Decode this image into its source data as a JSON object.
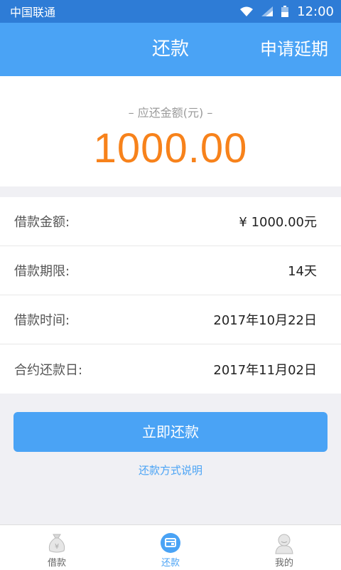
{
  "status_bar": {
    "carrier": "中国联通",
    "time": "12:00"
  },
  "header": {
    "title": "还款",
    "action": "申请延期"
  },
  "amount": {
    "label": "– 应还金额(元) –",
    "value": "1000.00"
  },
  "details": [
    {
      "label": "借款金额:",
      "value": "¥ 1000.00元"
    },
    {
      "label": "借款期限:",
      "value": "14天"
    },
    {
      "label": "借款时间:",
      "value": "2017年10月22日"
    },
    {
      "label": "合约还款日:",
      "value": "2017年11月02日"
    }
  ],
  "pay_button": "立即还款",
  "method_link": "还款方式说明",
  "tabs": [
    {
      "label": "借款",
      "icon": "money-bag-icon"
    },
    {
      "label": "还款",
      "icon": "card-icon",
      "active": true
    },
    {
      "label": "我的",
      "icon": "user-icon"
    }
  ],
  "colors": {
    "primary": "#4aa3f5",
    "status_bar": "#2e7cd6",
    "amount": "#f7821b"
  }
}
